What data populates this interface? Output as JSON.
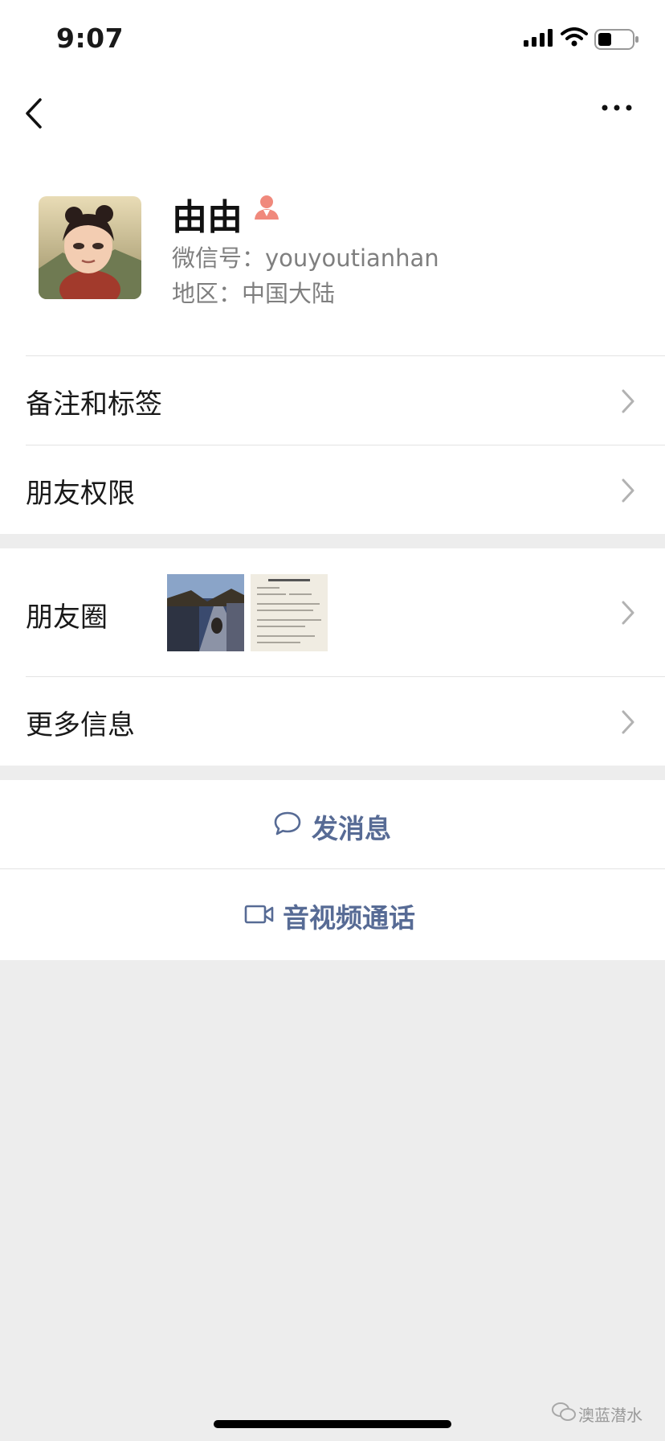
{
  "status_bar": {
    "time": "9:07"
  },
  "profile": {
    "name": "由由",
    "wechat_id_label": "微信号：youyoutianhan",
    "region_label": "地区：中国大陆"
  },
  "menu": {
    "notes_tags": "备注和标签",
    "friend_permissions": "朋友权限",
    "moments": "朋友圈",
    "more_info": "更多信息"
  },
  "actions": {
    "send_message": "发消息",
    "video_call": "音视频通话"
  },
  "watermark": {
    "text": "澳蓝潜水"
  },
  "colors": {
    "link_blue": "#576b95",
    "background": "#ededed",
    "gender_female": "#f0897c"
  }
}
